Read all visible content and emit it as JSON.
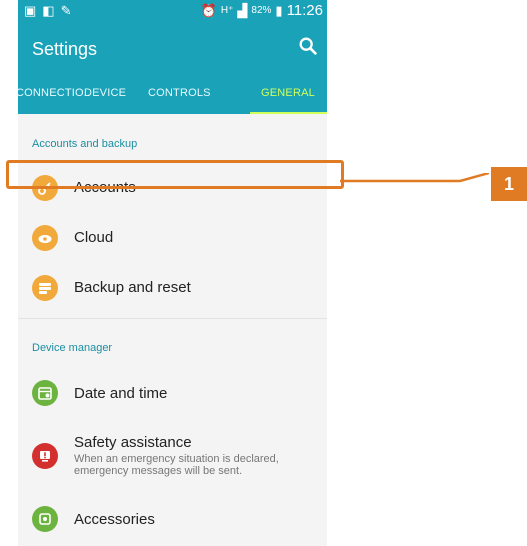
{
  "status_bar": {
    "battery_text": "82%",
    "time": "11:26"
  },
  "app_bar": {
    "title": "Settings"
  },
  "tabs": [
    {
      "label": "CONNECTIO.."
    },
    {
      "label": "DEVICE"
    },
    {
      "label": "CONTROLS"
    },
    {
      "label": "GENERAL",
      "selected": true
    }
  ],
  "sections": [
    {
      "title": "Accounts and backup",
      "items": [
        {
          "label": "Accounts",
          "icon": "key-icon",
          "color": "#f2a93b"
        },
        {
          "label": "Cloud",
          "icon": "cloud-icon",
          "color": "#f2a93b"
        },
        {
          "label": "Backup and reset",
          "icon": "backup-icon",
          "color": "#f2a93b"
        }
      ]
    },
    {
      "title": "Device manager",
      "items": [
        {
          "label": "Date and time",
          "icon": "calendar-icon",
          "color": "#6db33f"
        },
        {
          "label": "Safety assistance",
          "subtitle_line1": "When an emergency situation is declared,",
          "subtitle_line2": "emergency messages will be sent.",
          "icon": "alert-icon",
          "color": "#d32f2f"
        },
        {
          "label": "Accessories",
          "icon": "accessories-icon",
          "color": "#6db33f"
        }
      ]
    }
  ],
  "callout": {
    "number": "1",
    "color": "#e07b24"
  }
}
